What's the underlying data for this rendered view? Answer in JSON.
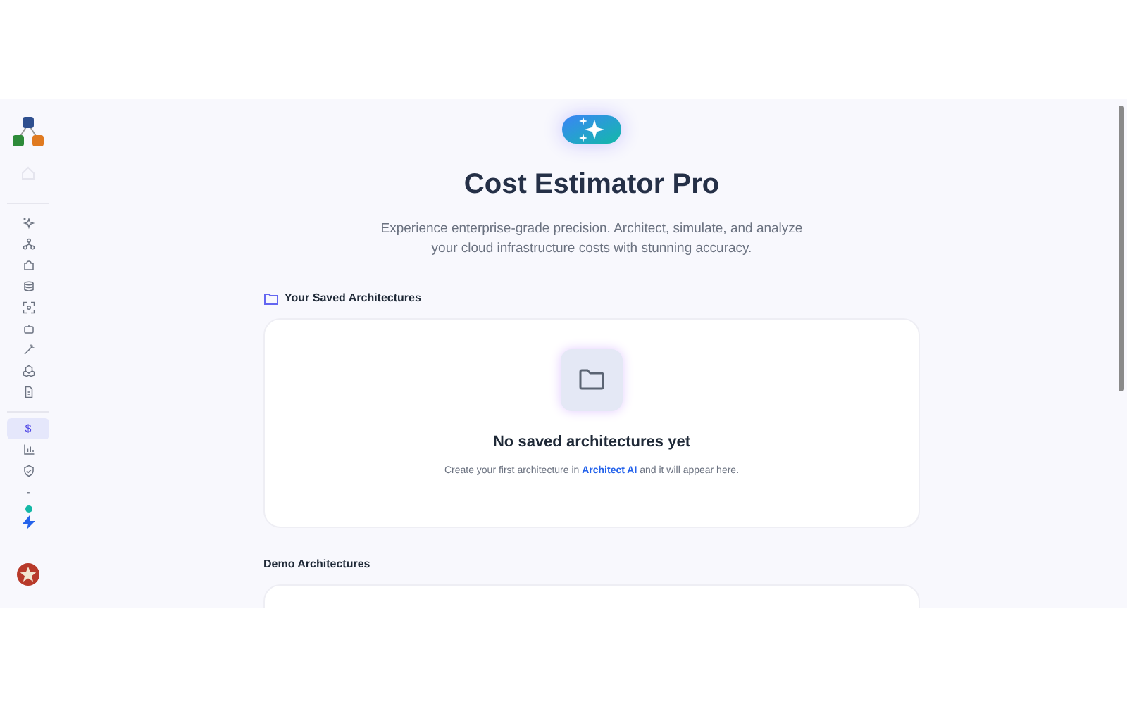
{
  "sidebar": {
    "nav_top": [
      {
        "kind": "sparkles",
        "selected": false
      },
      {
        "kind": "network",
        "selected": false
      },
      {
        "kind": "puzzle",
        "selected": false
      },
      {
        "kind": "database",
        "selected": false
      },
      {
        "kind": "scan",
        "selected": false
      },
      {
        "kind": "bot",
        "selected": false
      },
      {
        "kind": "wand",
        "selected": false
      },
      {
        "kind": "boxes",
        "selected": false
      },
      {
        "kind": "file",
        "selected": false
      }
    ],
    "nav_bottom": [
      {
        "kind": "text",
        "label": "$",
        "selected": true
      },
      {
        "kind": "chart",
        "selected": false
      },
      {
        "kind": "shield",
        "selected": false
      },
      {
        "kind": "text",
        "label": "-",
        "selected": false
      }
    ]
  },
  "header": {
    "title": "Cost Estimator Pro",
    "subtitle": "Experience enterprise-grade precision. Architect, simulate, and analyze your cloud infrastructure costs with stunning accuracy."
  },
  "saved": {
    "heading": "Your Saved Architectures",
    "empty_title": "No saved architectures yet",
    "empty_before": "Create your first architecture in",
    "link": "Architect AI",
    "empty_after": "and it will appear here."
  },
  "demo": {
    "heading": "Demo Architectures"
  }
}
